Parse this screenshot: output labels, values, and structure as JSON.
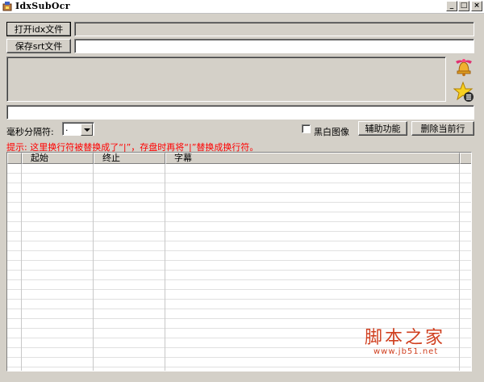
{
  "window": {
    "title": "IdxSubOcr",
    "minimize": "_",
    "maximize": "□",
    "close": "×"
  },
  "top": {
    "open_idx_label": "打开idx文件",
    "idx_path_value": "",
    "save_srt_label": "保存srt文件",
    "srt_path_value": ""
  },
  "preview": {
    "ocr_text_value": ""
  },
  "icons": {
    "bell": "bell-icon",
    "star": "star-list-icon"
  },
  "options": {
    "ms_sep_label": "毫秒分隔符:",
    "ms_sep_value": ".",
    "bw_label": "黑白图像",
    "bw_checked": false,
    "assist_label": "辅助功能",
    "delete_label": "删除当前行"
  },
  "hint": "提示: 这里换行符被替换成了“|”，存盘时再将“|”替换成换行符。",
  "table": {
    "columns": [
      "",
      "起始",
      "终止",
      "字幕"
    ],
    "rows": []
  },
  "watermark": {
    "name": "脚本之家",
    "url": "www.jb51.net"
  },
  "colors": {
    "face": "#d4d0c8",
    "hint": "#ff0000",
    "watermark": "#d04020"
  }
}
